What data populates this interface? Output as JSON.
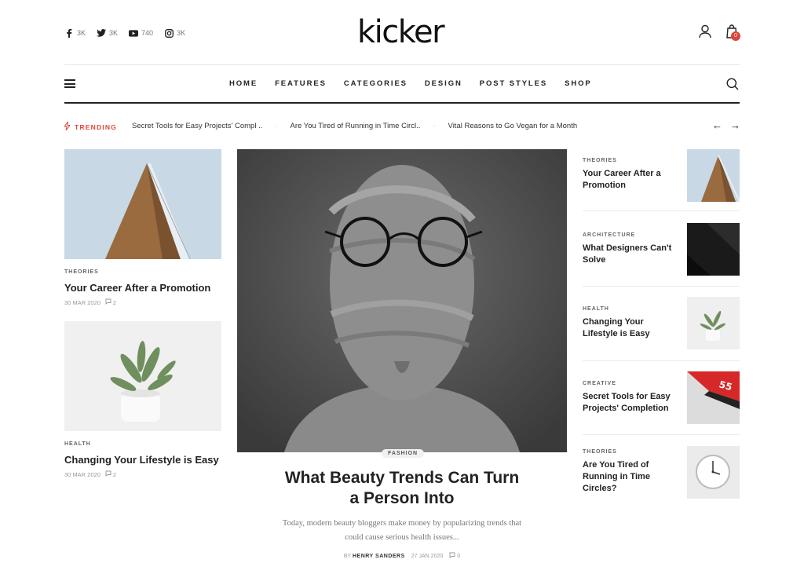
{
  "header": {
    "logo": "kicker",
    "social": [
      {
        "icon": "facebook-icon",
        "count": "3K"
      },
      {
        "icon": "twitter-icon",
        "count": "3K"
      },
      {
        "icon": "youtube-icon",
        "count": "740"
      },
      {
        "icon": "instagram-icon",
        "count": "3K"
      }
    ],
    "cart_count": "0"
  },
  "nav": {
    "items": [
      "HOME",
      "FEATURES",
      "CATEGORIES",
      "DESIGN",
      "POST STYLES",
      "SHOP"
    ]
  },
  "trending": {
    "label": "TRENDING",
    "items": [
      "Secret Tools for Easy Projects' Compl ..",
      "Are You Tired of Running in Time Circl..",
      "Vital Reasons to Go Vegan for a Month"
    ]
  },
  "left_posts": [
    {
      "category": "THEORIES",
      "title": "Your Career After a Promotion",
      "date": "30 MAR 2020",
      "comments": "2"
    },
    {
      "category": "HEALTH",
      "title": "Changing Your Lifestyle is Easy",
      "date": "30 MAR 2020",
      "comments": "2"
    }
  ],
  "featured": {
    "category": "FASHION",
    "title_line1": "What Beauty Trends Can Turn",
    "title_line2": "a Person Into",
    "excerpt_line1": "Today, modern beauty bloggers make money by popularizing trends that",
    "excerpt_line2": "could cause serious health issues...",
    "by": "BY",
    "author": "HENRY SANDERS",
    "date": "27 JAN 2020",
    "comments": "0"
  },
  "right_posts": [
    {
      "category": "THEORIES",
      "title": "Your Career After a Promotion"
    },
    {
      "category": "ARCHITECTURE",
      "title": "What Designers Can't Solve"
    },
    {
      "category": "HEALTH",
      "title": "Changing Your Lifestyle is Easy"
    },
    {
      "category": "CREATIVE",
      "title": "Secret Tools for Easy Projects' Completion"
    },
    {
      "category": "THEORIES",
      "title": "Are You Tired of Running in Time Circles?"
    }
  ],
  "colors": {
    "accent": "#e0453a"
  }
}
